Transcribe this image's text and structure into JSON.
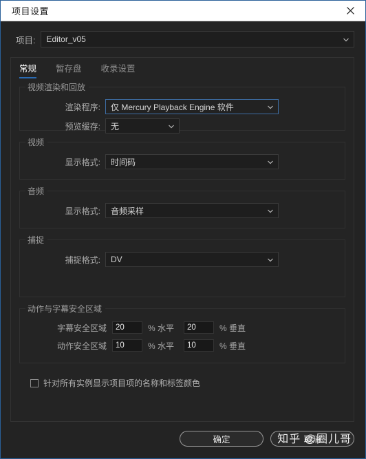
{
  "window": {
    "title": "项目设置",
    "close_icon": "close-icon",
    "accent_color": "#2a6099",
    "titlebar_bg": "#ffffff",
    "body_bg": "#232323"
  },
  "project": {
    "label": "项目:",
    "value": "Editor_v05"
  },
  "tabs": [
    {
      "label": "常规",
      "active": true
    },
    {
      "label": "暂存盘",
      "active": false
    },
    {
      "label": "收录设置",
      "active": false
    }
  ],
  "groups": {
    "video_render": {
      "legend": "视频渲染和回放",
      "renderer": {
        "label": "渲染程序:",
        "value": "仅 Mercury Playback Engine 软件",
        "focused": true
      },
      "preview_cache": {
        "label": "预览缓存:",
        "value": "无",
        "focused": false
      }
    },
    "video": {
      "legend": "视频",
      "display_format": {
        "label": "显示格式:",
        "value": "时间码"
      }
    },
    "audio": {
      "legend": "音频",
      "display_format": {
        "label": "显示格式:",
        "value": "音频采样"
      }
    },
    "capture": {
      "legend": "捕捉",
      "capture_format": {
        "label": "捕捉格式:",
        "value": "DV"
      }
    },
    "safe_areas": {
      "legend": "动作与字幕安全区域",
      "title_safe": {
        "label": "字幕安全区域",
        "horizontal": "20",
        "vertical": "20",
        "unit_h": "% 水平",
        "unit_v": "% 垂直"
      },
      "action_safe": {
        "label": "动作安全区域",
        "horizontal": "10",
        "vertical": "10",
        "unit_h": "% 水平",
        "unit_v": "% 垂直"
      }
    }
  },
  "checkbox": {
    "label": "针对所有实例显示项目项的名称和标签颜色",
    "checked": false
  },
  "footer": {
    "ok_label": "确定",
    "cancel_label": "取消",
    "watermark": "知乎 @圈儿哥"
  }
}
